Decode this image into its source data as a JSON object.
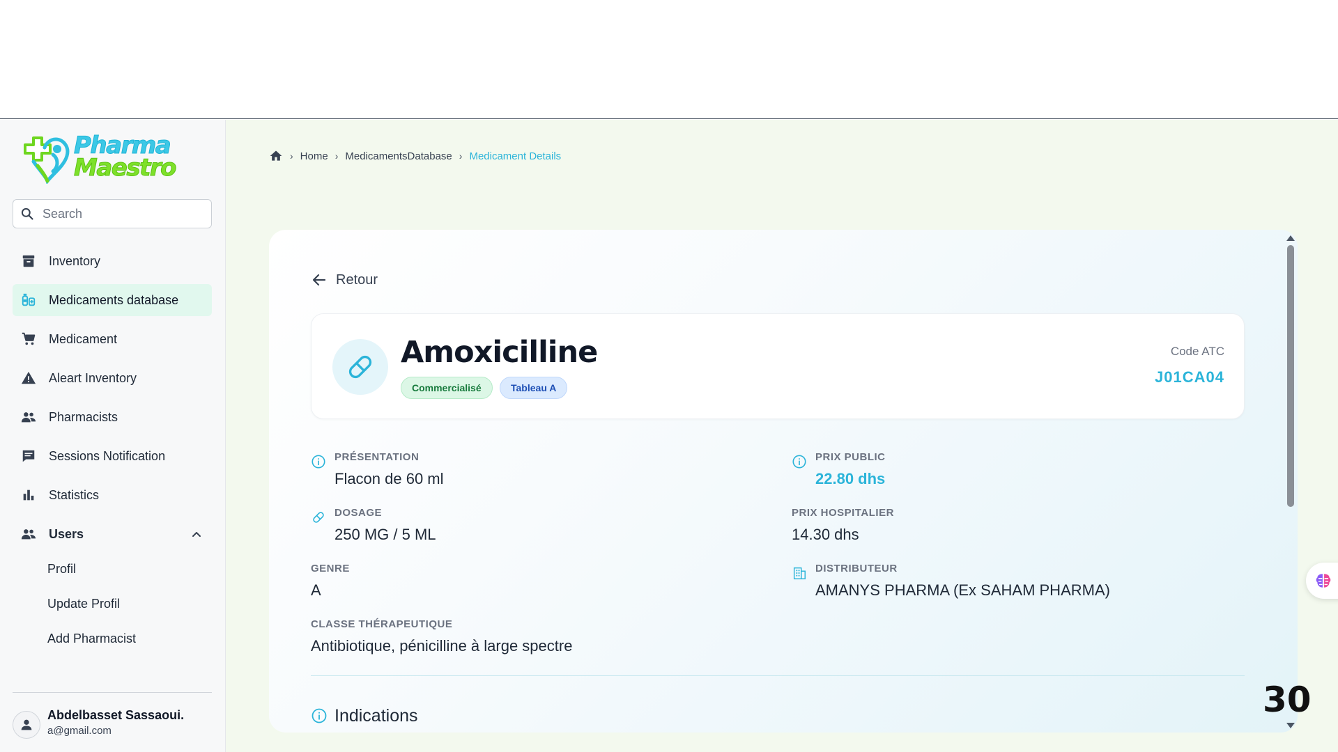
{
  "logo": {
    "line1": "Pharma",
    "line2": "Maestro"
  },
  "search": {
    "placeholder": "Search"
  },
  "nav": {
    "items": [
      {
        "label": "Inventory",
        "icon": "archive-icon"
      },
      {
        "label": "Medicaments database",
        "icon": "medicine-icon",
        "active": true
      },
      {
        "label": "Medicament",
        "icon": "cart-icon"
      },
      {
        "label": "Aleart Inventory",
        "icon": "warning-icon"
      },
      {
        "label": "Pharmacists",
        "icon": "people-icon"
      },
      {
        "label": "Sessions Notification",
        "icon": "chat-icon"
      },
      {
        "label": "Statistics",
        "icon": "bar-chart-icon"
      }
    ],
    "users": {
      "label": "Users",
      "icon": "people-icon",
      "expanded": true,
      "children": [
        "Profil",
        "Update Profil",
        "Add Pharmacist"
      ]
    }
  },
  "user": {
    "name": "Abdelbasset Sassaoui.",
    "email": "a@gmail.com"
  },
  "breadcrumb": {
    "items": [
      "Home",
      "MedicamentsDatabase"
    ],
    "current": "Medicament Details"
  },
  "back_label": "Retour",
  "medicament": {
    "name": "Amoxicilline",
    "badges": [
      "Commercialisé",
      "Tableau A"
    ],
    "atc_label": "Code ATC",
    "atc_code": "J01CA04"
  },
  "fields": {
    "presentation": {
      "label": "Présentation",
      "value": "Flacon de 60 ml"
    },
    "prix_public": {
      "label": "Prix public",
      "value": "22.80 dhs"
    },
    "dosage": {
      "label": "Dosage",
      "value": "250 MG / 5 ML"
    },
    "prix_hospitalier": {
      "label": "Prix hospitalier",
      "value": "14.30 dhs"
    },
    "genre": {
      "label": "Genre",
      "value": "A"
    },
    "distributeur": {
      "label": "Distributeur",
      "value": "AMANYS PHARMA (Ex SAHAM PHARMA)"
    },
    "classe": {
      "label": "Classe thérapeutique",
      "value": "Antibiotique, pénicilline à large spectre"
    }
  },
  "indications_title": "Indications",
  "page_number": "30",
  "colors": {
    "accent": "#2bb4d9",
    "brand_green": "#7ee02a",
    "active_bg": "#e1f8ee",
    "app_bg": "#f3f9ee"
  }
}
